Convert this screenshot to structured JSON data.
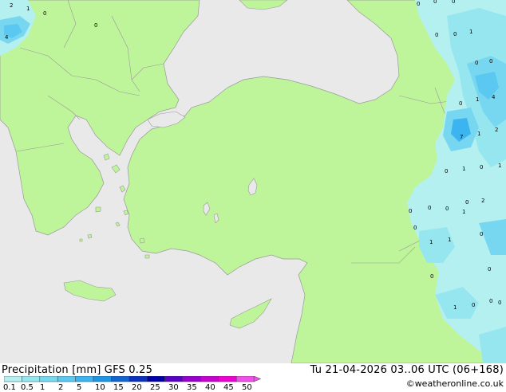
{
  "map": {
    "precip_values": [
      {
        "v": "2"
      },
      {
        "v": "1"
      },
      {
        "v": "0"
      },
      {
        "v": "4"
      },
      {
        "v": "0"
      },
      {
        "v": "0"
      },
      {
        "v": "0"
      },
      {
        "v": "0"
      },
      {
        "v": "0"
      },
      {
        "v": "0"
      },
      {
        "v": "1"
      },
      {
        "v": "0"
      },
      {
        "v": "0"
      },
      {
        "v": "1"
      },
      {
        "v": "4"
      },
      {
        "v": "0"
      },
      {
        "v": "1"
      },
      {
        "v": "2"
      },
      {
        "v": "7"
      },
      {
        "v": "1"
      },
      {
        "v": "0"
      },
      {
        "v": "0"
      },
      {
        "v": "1"
      },
      {
        "v": "2"
      },
      {
        "v": "0"
      },
      {
        "v": "0"
      },
      {
        "v": "0"
      },
      {
        "v": "0"
      },
      {
        "v": "1"
      },
      {
        "v": "0"
      },
      {
        "v": "0"
      },
      {
        "v": "1"
      },
      {
        "v": "1"
      },
      {
        "v": "0"
      },
      {
        "v": "0"
      },
      {
        "v": "1"
      },
      {
        "v": "0"
      },
      {
        "v": "0"
      },
      {
        "v": "0"
      }
    ]
  },
  "legend": {
    "title": "Precipitation [mm]  GFS 0.25",
    "datetime": "Tu 21-04-2026 03..06 UTC (06+168)",
    "credit": "©weatheronline.co.uk",
    "labels": [
      "0.1",
      "0.5",
      "1",
      "2",
      "5",
      "10",
      "15",
      "20",
      "25",
      "30",
      "35",
      "40",
      "45",
      "50"
    ],
    "colors": [
      "#b4f0f0",
      "#96e6f0",
      "#78d7f0",
      "#5ac8f0",
      "#3cb4f0",
      "#1e96e6",
      "#1464d2",
      "#0a32be",
      "#0000aa",
      "#5a00c8",
      "#9600d2",
      "#c800d2",
      "#f000d2",
      "#f050e6"
    ]
  }
}
